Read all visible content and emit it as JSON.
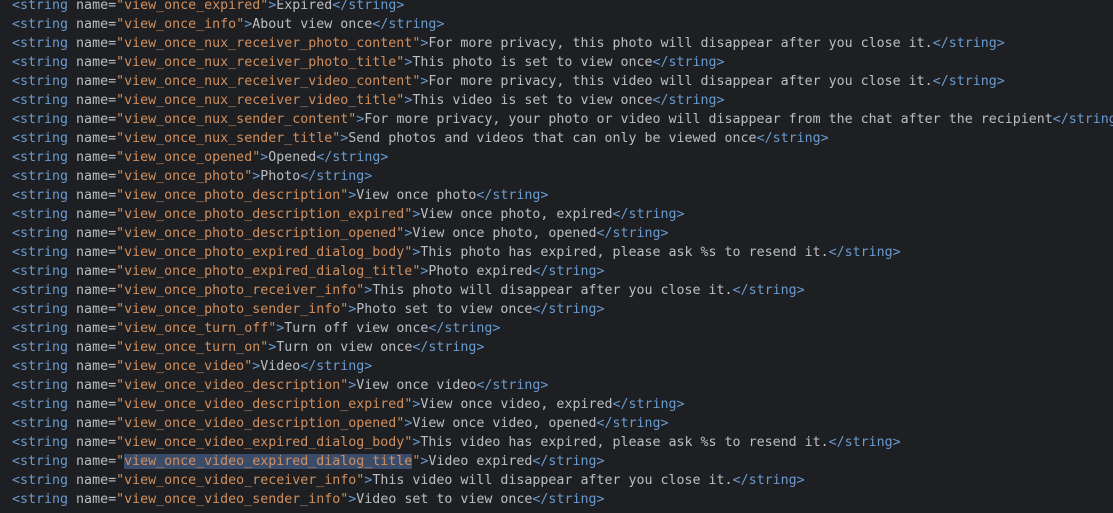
{
  "editor": {
    "open_tag": "<string",
    "attr_label": " name=",
    "gt": ">",
    "close_tag": "</string>",
    "quote": "\""
  },
  "lines": [
    {
      "key": "view_once_expired",
      "text": "Expired"
    },
    {
      "key": "view_once_info",
      "text": "About view once"
    },
    {
      "key": "view_once_nux_receiver_photo_content",
      "text": "For more privacy, this photo will disappear after you close it."
    },
    {
      "key": "view_once_nux_receiver_photo_title",
      "text": "This photo is set to view once"
    },
    {
      "key": "view_once_nux_receiver_video_content",
      "text": "For more privacy, this video will disappear after you close it."
    },
    {
      "key": "view_once_nux_receiver_video_title",
      "text": "This video is set to view once"
    },
    {
      "key": "view_once_nux_sender_content",
      "text": "For more privacy, your photo or video will disappear from the chat after the recipient"
    },
    {
      "key": "view_once_nux_sender_title",
      "text": "Send photos and videos that can only be viewed once"
    },
    {
      "key": "view_once_opened",
      "text": "Opened"
    },
    {
      "key": "view_once_photo",
      "text": "Photo"
    },
    {
      "key": "view_once_photo_description",
      "text": "View once photo"
    },
    {
      "key": "view_once_photo_description_expired",
      "text": "View once photo, expired"
    },
    {
      "key": "view_once_photo_description_opened",
      "text": "View once photo, opened"
    },
    {
      "key": "view_once_photo_expired_dialog_body",
      "text": "This photo has expired, please ask %s to resend it."
    },
    {
      "key": "view_once_photo_expired_dialog_title",
      "text": "Photo expired"
    },
    {
      "key": "view_once_photo_receiver_info",
      "text": "This photo will disappear after you close it."
    },
    {
      "key": "view_once_photo_sender_info",
      "text": "Photo set to view once"
    },
    {
      "key": "view_once_turn_off",
      "text": "Turn off view once"
    },
    {
      "key": "view_once_turn_on",
      "text": "Turn on view once"
    },
    {
      "key": "view_once_video",
      "text": "Video"
    },
    {
      "key": "view_once_video_description",
      "text": "View once video"
    },
    {
      "key": "view_once_video_description_expired",
      "text": "View once video, expired"
    },
    {
      "key": "view_once_video_description_opened",
      "text": "View once video, opened"
    },
    {
      "key": "view_once_video_expired_dialog_body",
      "text": "This video has expired, please ask %s to resend it."
    },
    {
      "key": "view_once_video_expired_dialog_title",
      "text": "Video expired",
      "selected": true
    },
    {
      "key": "view_once_video_receiver_info",
      "text": "This video will disappear after you close it."
    },
    {
      "key": "view_once_video_sender_info",
      "text": "Video set to view once"
    }
  ]
}
